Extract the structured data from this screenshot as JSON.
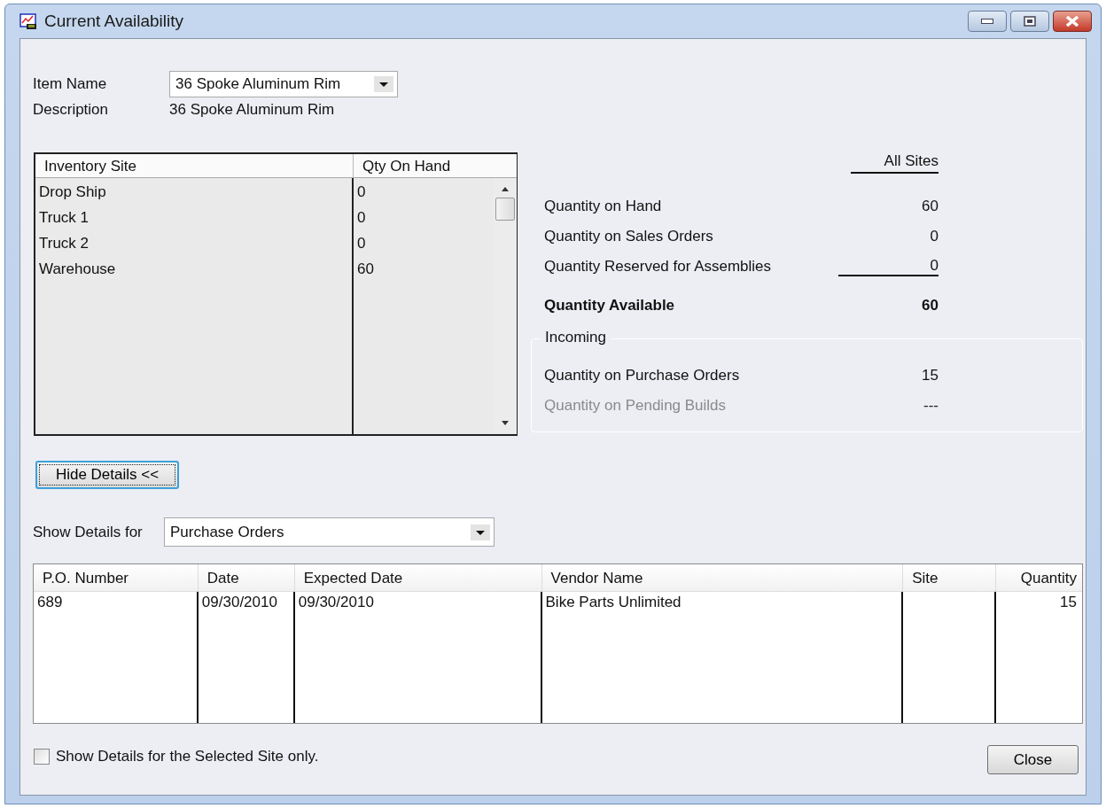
{
  "window": {
    "title": "Current Availability"
  },
  "item": {
    "label": "Item Name",
    "value": "36 Spoke Aluminum Rim"
  },
  "description": {
    "label": "Description",
    "value": "36 Spoke Aluminum Rim"
  },
  "sites": {
    "columns": [
      "Inventory Site",
      "Qty On Hand"
    ],
    "rows": [
      {
        "site": "Drop Ship",
        "qty": "0"
      },
      {
        "site": "Truck 1",
        "qty": "0"
      },
      {
        "site": "Truck 2",
        "qty": "0"
      },
      {
        "site": "Warehouse",
        "qty": "60"
      }
    ]
  },
  "summary": {
    "heading": "All Sites",
    "rows": [
      {
        "label": "Quantity on Hand",
        "value": "60",
        "kind": "plain"
      },
      {
        "label": "Quantity on Sales Orders",
        "value": "0",
        "kind": "plain"
      },
      {
        "label": "Quantity Reserved for Assemblies",
        "value": "0",
        "kind": "underlined"
      },
      {
        "label": "Quantity Available",
        "value": "60",
        "kind": "total"
      }
    ]
  },
  "incoming": {
    "title": "Incoming",
    "rows": [
      {
        "label": "Quantity on Purchase Orders",
        "value": "15",
        "disabled": false
      },
      {
        "label": "Quantity on Pending Builds",
        "value": "---",
        "disabled": true
      }
    ]
  },
  "hide_details_button": "Hide Details <<",
  "show_details": {
    "label": "Show Details for",
    "value": "Purchase Orders"
  },
  "orders": {
    "columns": [
      "P.O. Number",
      "Date",
      "Expected Date",
      "Vendor Name",
      "Site",
      "Quantity"
    ],
    "rows": [
      {
        "po_number": "689",
        "date": "09/30/2010",
        "expected_date": "09/30/2010",
        "vendor_name": "Bike Parts Unlimited",
        "quantity": "15"
      }
    ]
  },
  "site_only": {
    "label": "Show Details for the Selected Site only.",
    "checked": false
  },
  "close_button": "Close"
}
